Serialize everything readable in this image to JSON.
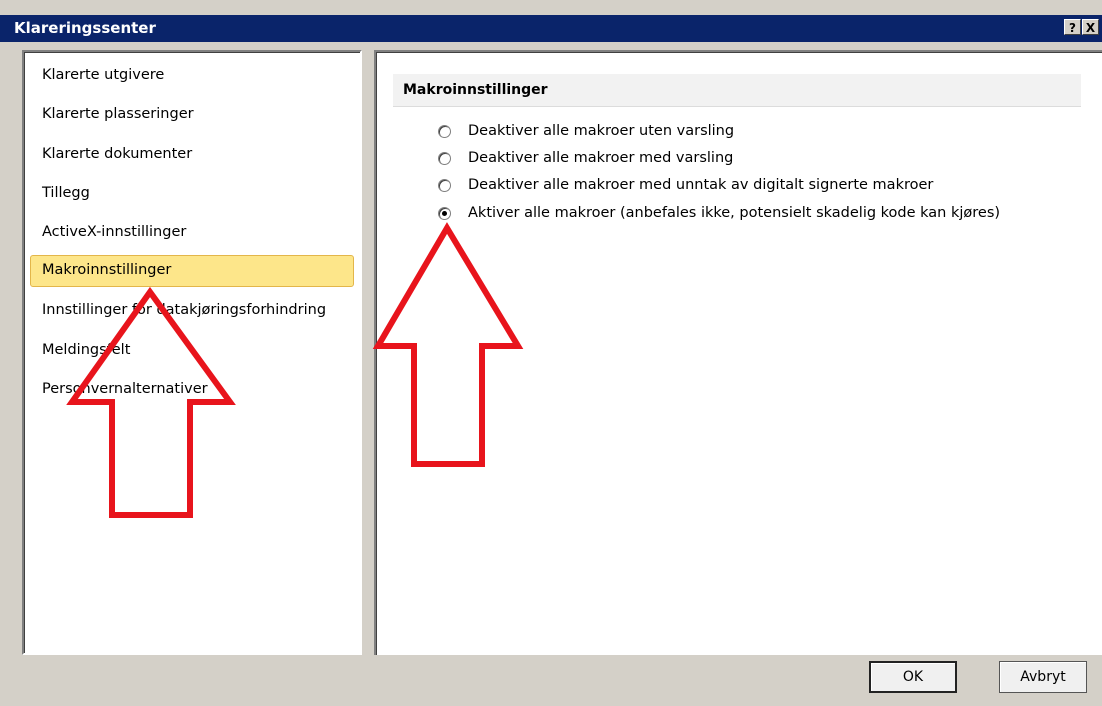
{
  "window": {
    "title": "Klareringssenter",
    "help_label": "?",
    "close_label": "X"
  },
  "nav": {
    "items": [
      {
        "label": "Klarerte utgivere"
      },
      {
        "label": "Klarerte plasseringer"
      },
      {
        "label": "Klarerte dokumenter"
      },
      {
        "label": "Tillegg"
      },
      {
        "label": "ActiveX-innstillinger"
      },
      {
        "label": "Makroinnstillinger",
        "selected": true
      },
      {
        "label": "Innstillinger for datakjøringsforhindring"
      },
      {
        "label": "Meldingsfelt"
      },
      {
        "label": "Personvernalternativer"
      }
    ]
  },
  "main": {
    "section_title": "Makroinnstillinger",
    "options": [
      {
        "label": "Deaktiver alle makroer uten varsling",
        "checked": false
      },
      {
        "label": "Deaktiver alle makroer med varsling",
        "checked": false
      },
      {
        "label": "Deaktiver alle makroer med unntak av digitalt signerte makroer",
        "checked": false
      },
      {
        "label": "Aktiver alle makroer (anbefales ikke, potensielt skadelig kode kan kjøres)",
        "checked": true
      }
    ]
  },
  "footer": {
    "ok_label": "OK",
    "cancel_label": "Avbryt"
  },
  "annotations": {
    "arrow_color": "#e8141c"
  }
}
